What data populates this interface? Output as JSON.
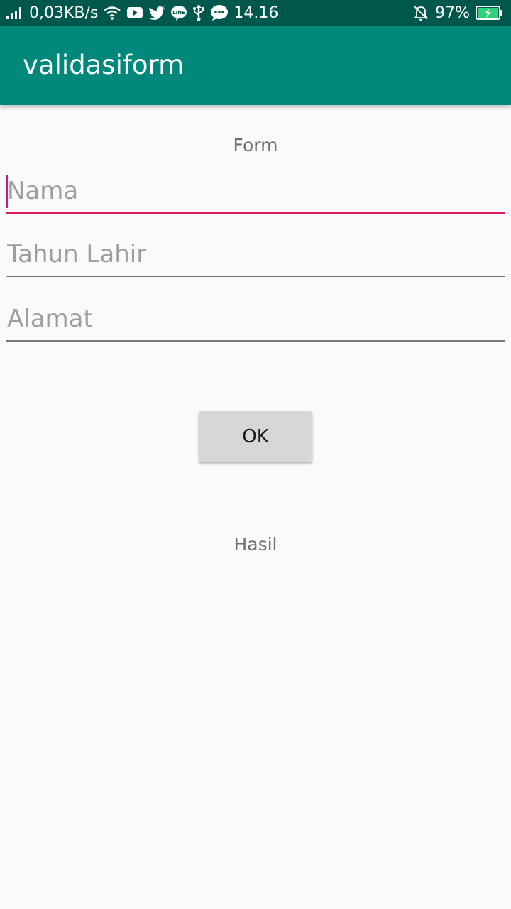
{
  "status_bar": {
    "speed": "0,03KB/s",
    "time": "14.16",
    "battery": "97%",
    "icons": [
      "signal-icon",
      "wifi-icon",
      "youtube-icon",
      "twitter-icon",
      "line-icon",
      "usb-icon",
      "chat-icon",
      "bell-off-icon",
      "battery-charging-icon"
    ]
  },
  "app_bar": {
    "title": "validasiform"
  },
  "form": {
    "label": "Form",
    "fields": [
      {
        "placeholder": "Nama",
        "value": ""
      },
      {
        "placeholder": "Tahun Lahir",
        "value": ""
      },
      {
        "placeholder": "Alamat",
        "value": ""
      }
    ],
    "ok_label": "OK",
    "result_label": "Hasil"
  },
  "colors": {
    "status_bar": "#00574b",
    "app_bar": "#00897b",
    "accent": "#d81b60",
    "background": "#fafafa"
  }
}
